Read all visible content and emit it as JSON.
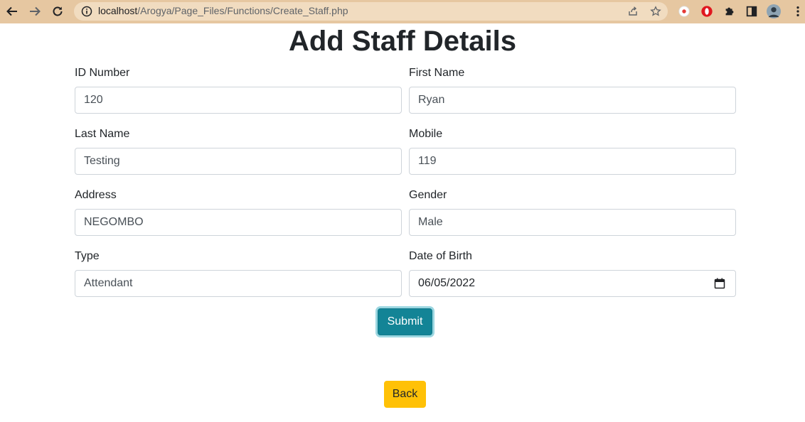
{
  "browser": {
    "url_host": "localhost",
    "url_path": "/Arogya/Page_Files/Functions/Create_Staff.php"
  },
  "page": {
    "title": "Add Staff Details"
  },
  "form": {
    "id_number": {
      "label": "ID Number",
      "value": "120"
    },
    "first_name": {
      "label": "First Name",
      "value": "Ryan"
    },
    "last_name": {
      "label": "Last Name",
      "value": "Testing"
    },
    "mobile": {
      "label": "Mobile",
      "value": "119"
    },
    "address": {
      "label": "Address",
      "value": "NEGOMBO"
    },
    "gender": {
      "label": "Gender",
      "value": "Male"
    },
    "type": {
      "label": "Type",
      "value": "Attendant"
    },
    "dob": {
      "label": "Date of Birth",
      "value": "06/05/2022"
    },
    "submit_label": "Submit"
  },
  "back_label": "Back",
  "colors": {
    "submit_bg": "#138496",
    "back_bg": "#ffc107",
    "toolbar_bg": "#e6c7a1"
  },
  "icons": {
    "back": "arrow-left-icon",
    "forward": "arrow-right-icon",
    "reload": "reload-icon",
    "info": "info-icon",
    "share": "share-icon",
    "bookmark": "star-icon",
    "extensions": "puzzle-icon",
    "calendar": "calendar-icon"
  }
}
